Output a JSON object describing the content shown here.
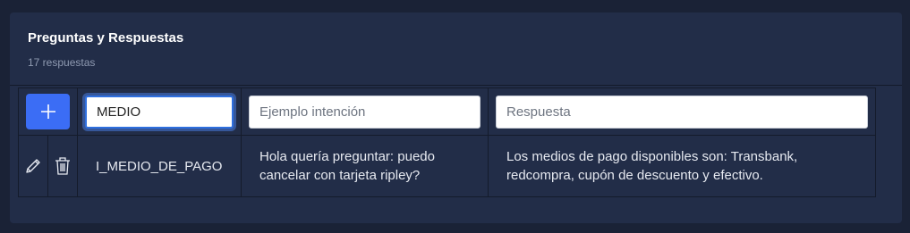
{
  "panel": {
    "title": "Preguntas y Respuestas",
    "subtitle": "17 respuestas"
  },
  "form": {
    "intent_value": "MEDIO",
    "example_placeholder": "Ejemplo intención",
    "answer_placeholder": "Respuesta"
  },
  "rows": [
    {
      "intent": "I_MEDIO_DE_PAGO",
      "question": "Hola quería preguntar: puedo cancelar con tarjeta ripley?",
      "answer": "Los medios de pago disponibles son: Transbank, redcompra, cupón de descuento y efectivo."
    }
  ],
  "icons": {
    "add": "plus-icon",
    "edit": "pencil-icon",
    "delete": "trash-icon"
  },
  "colors": {
    "accent": "#3b6df5",
    "card": "#222d48",
    "background": "#1a2236"
  }
}
